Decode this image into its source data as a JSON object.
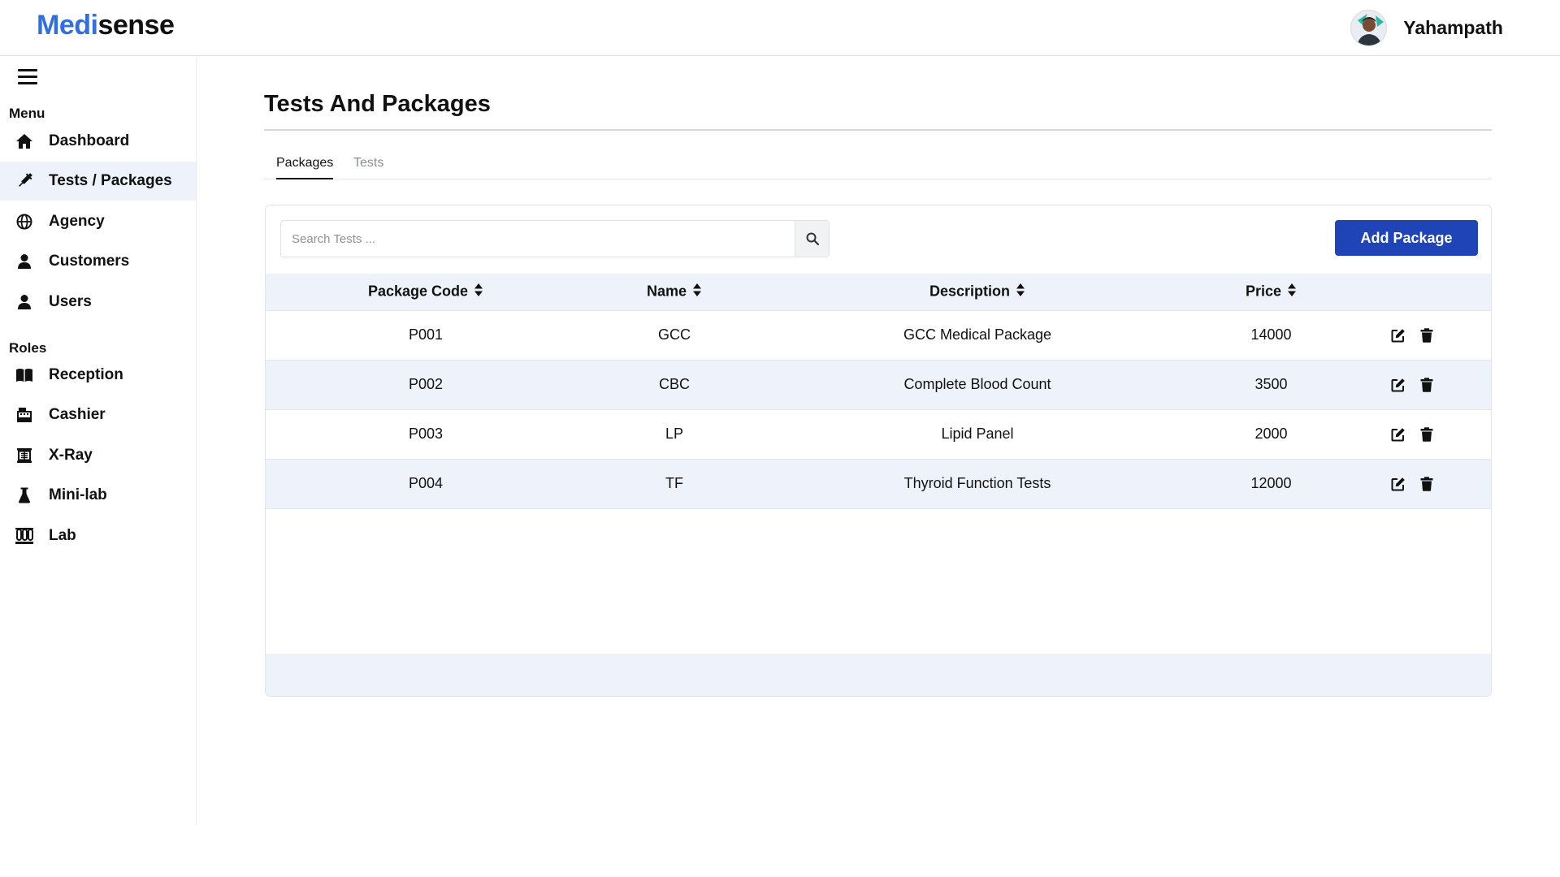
{
  "app": {
    "logo_part1": "Medi",
    "logo_part2": "sense",
    "user_name": "Yahampath"
  },
  "sidebar": {
    "menu_title": "Menu",
    "menu_items": [
      {
        "label": "Dashboard",
        "icon": "home-icon"
      },
      {
        "label": "Tests / Packages",
        "icon": "syringe-icon",
        "active": true
      },
      {
        "label": "Agency",
        "icon": "globe-icon"
      },
      {
        "label": "Customers",
        "icon": "user-icon"
      },
      {
        "label": "Users",
        "icon": "user-icon"
      }
    ],
    "roles_title": "Roles",
    "role_items": [
      {
        "label": "Reception",
        "icon": "book-open-icon"
      },
      {
        "label": "Cashier",
        "icon": "cash-register-icon"
      },
      {
        "label": "X-Ray",
        "icon": "x-ray-icon"
      },
      {
        "label": "Mini-lab",
        "icon": "flask-icon"
      },
      {
        "label": "Lab",
        "icon": "vials-icon"
      }
    ]
  },
  "main": {
    "title": "Tests And Packages",
    "tabs": [
      {
        "label": "Packages",
        "active": true
      },
      {
        "label": "Tests",
        "active": false
      }
    ],
    "search": {
      "placeholder": "Search Tests ..."
    },
    "add_button": "Add Package",
    "table": {
      "columns": [
        "Package Code",
        "Name",
        "Description",
        "Price"
      ],
      "rows": [
        {
          "code": "P001",
          "name": "GCC",
          "description": "GCC Medical Package",
          "price": "14000"
        },
        {
          "code": "P002",
          "name": "CBC",
          "description": "Complete Blood Count",
          "price": "3500"
        },
        {
          "code": "P003",
          "name": "LP",
          "description": "Lipid Panel",
          "price": "2000"
        },
        {
          "code": "P004",
          "name": "TF",
          "description": "Thyroid Function Tests",
          "price": "12000"
        }
      ]
    }
  },
  "colors": {
    "brand_blue": "#2f6fe0",
    "button_blue": "#1f44b8",
    "row_highlight": "#eef3fb"
  }
}
